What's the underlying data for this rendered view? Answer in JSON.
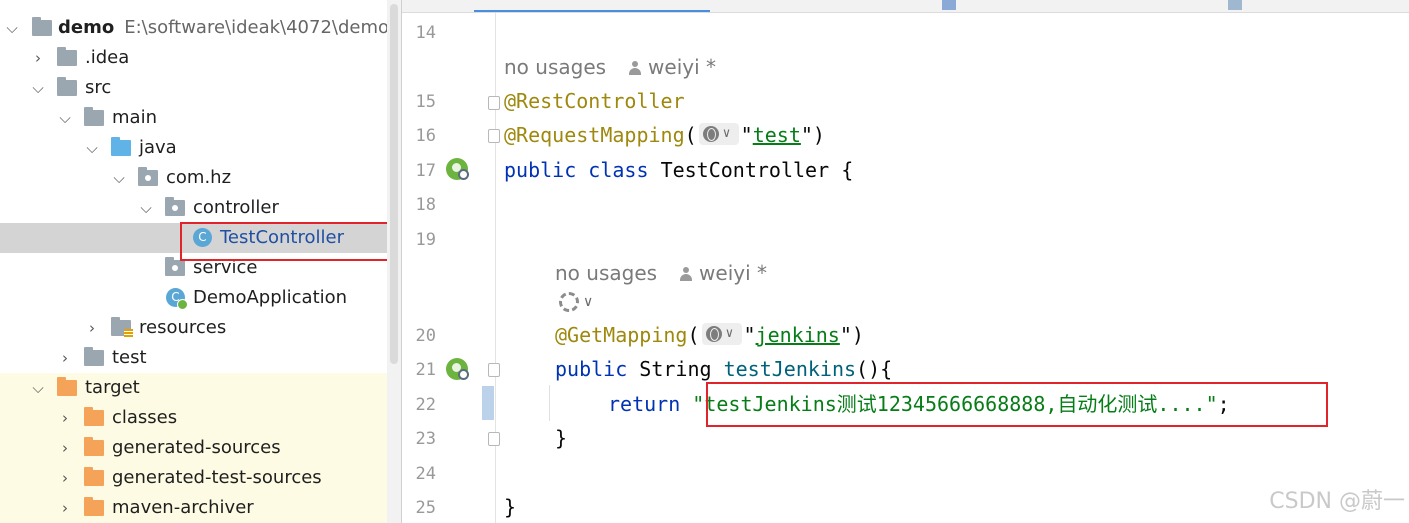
{
  "project_tree": {
    "root": {
      "name": "demo",
      "path": "E:\\software\\ideak\\4072\\demo"
    },
    "items": [
      {
        "label": ".idea"
      },
      {
        "label": "src"
      },
      {
        "label": "main"
      },
      {
        "label": "java"
      },
      {
        "label": "com.hz"
      },
      {
        "label": "controller"
      },
      {
        "label": "TestController"
      },
      {
        "label": "service"
      },
      {
        "label": "DemoApplication"
      },
      {
        "label": "resources"
      },
      {
        "label": "test"
      },
      {
        "label": "target"
      },
      {
        "label": "classes"
      },
      {
        "label": "generated-sources"
      },
      {
        "label": "generated-test-sources"
      },
      {
        "label": "maven-archiver"
      }
    ]
  },
  "editor": {
    "line_numbers": [
      "14",
      "15",
      "16",
      "17",
      "18",
      "19",
      "20",
      "21",
      "22",
      "23",
      "24",
      "25"
    ],
    "hints": {
      "usages": "no usages",
      "author": "weiyi *"
    },
    "code": {
      "ann_rest": "@RestController",
      "ann_reqmap": "@RequestMapping",
      "reqmap_value": "test",
      "kw_public": "public",
      "kw_class": "class",
      "class_name": "TestController",
      "open_brace": "{",
      "ann_getmap": "@GetMapping",
      "getmap_value": "jenkins",
      "type_string": "String",
      "method_name": "testJenkins",
      "method_sig_tail": "(){",
      "kw_return": "return",
      "return_value": "testJenkins测试12345666668888,自动化测试....",
      "semicolon": ";",
      "close_brace": "}"
    }
  },
  "watermark": "CSDN @蔚一",
  "colors": {
    "annotation": "#9e880d",
    "keyword": "#0033b3",
    "string": "#067d17",
    "method": "#00627a",
    "highlight_box": "#e0242a",
    "excluded_bg": "#fdfbe3",
    "selected_bg": "#d4d4d4"
  }
}
